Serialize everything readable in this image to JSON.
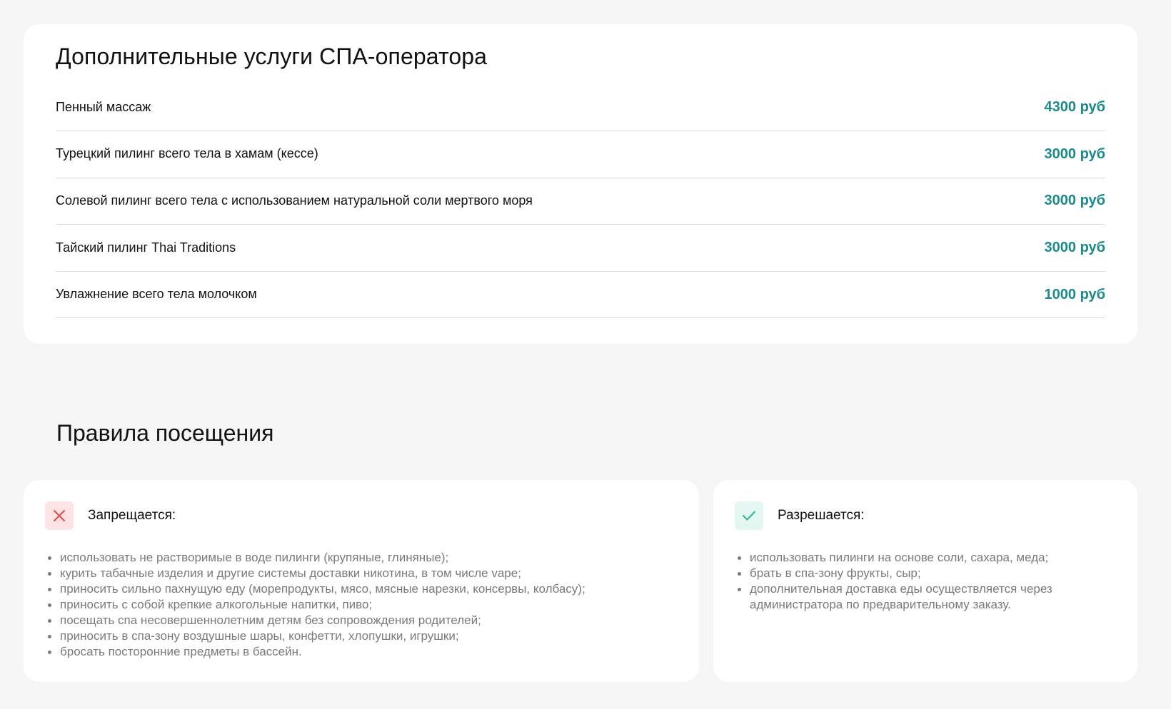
{
  "services": {
    "title": "Дополнительные услуги СПА-оператора",
    "items": [
      {
        "name": "Пенный массаж",
        "price": "4300 руб"
      },
      {
        "name": "Турецкий пилинг всего тела в хамам (кессе)",
        "price": "3000 руб"
      },
      {
        "name": "Солевой пилинг всего тела с использованием натуральной соли мертвого моря",
        "price": "3000 руб"
      },
      {
        "name": "Тайский пилинг Thai Traditions",
        "price": "3000 руб"
      },
      {
        "name": "Увлажнение всего тела молочком",
        "price": "1000 руб"
      }
    ]
  },
  "rules": {
    "title": "Правила посещения",
    "forbidden": {
      "heading": "Запрещается:",
      "icon": "cross-icon",
      "icon_color": "#e5484d",
      "items": [
        "использовать не растворимые в воде пилинги (крупяные, глиняные);",
        "курить табачные изделия и другие системы доставки никотина, в том числе vape;",
        "приносить сильно пахнущую еду (морепродукты, мясо, мясные нарезки, консервы, колбасу);",
        "приносить с собой крепкие алкогольные напитки, пиво;",
        "посещать спа несовершеннолетним детям без сопровождения родителей;",
        "приносить в спа-зону воздушные шары, конфетти, хлопушки, игрушки;",
        "бросать посторонние предметы в бассейн."
      ]
    },
    "allowed": {
      "heading": "Разрешается:",
      "icon": "check-icon",
      "icon_color": "#2ab595",
      "items": [
        "использовать пилинги на основе соли, сахара, меда;",
        "брать в спа-зону фрукты, сыр;",
        "дополнительная доставка еды осуществляется через администратора по предварительному заказу."
      ]
    }
  },
  "colors": {
    "background": "#f5f5f5",
    "card": "#ffffff",
    "price": "#1c8a8c",
    "muted_text": "#7a7a7a"
  }
}
